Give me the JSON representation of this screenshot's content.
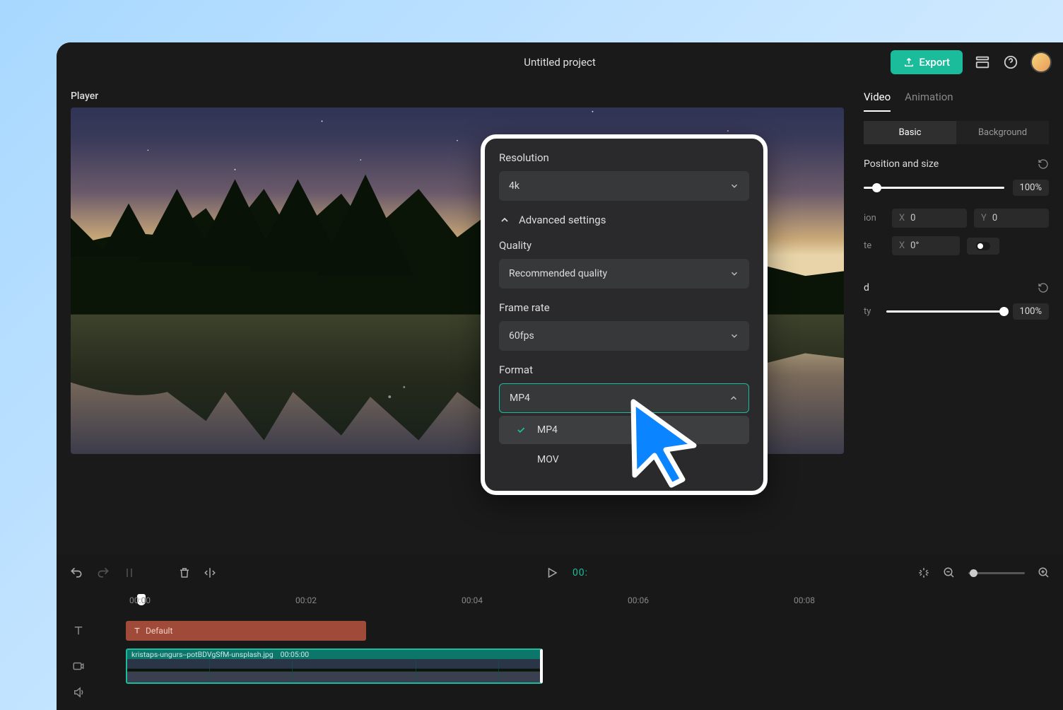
{
  "titlebar": {
    "title": "Untitled project",
    "export_label": "Export"
  },
  "player": {
    "label": "Player"
  },
  "rightPanel": {
    "tabs": {
      "video": "Video",
      "animation": "Animation"
    },
    "subtabs": {
      "basic": "Basic",
      "background": "Background"
    },
    "posSize": {
      "heading": "Position and size",
      "scale_pct": "100%",
      "pos_label_part": "ion",
      "posX": "0",
      "posY": "0",
      "rotate_label_part": "te",
      "rotX": "0°"
    },
    "blend": {
      "heading_part": "d",
      "opacity_label_part": "ty",
      "opacity_pct": "100%"
    }
  },
  "toolbar": {
    "time": "00:"
  },
  "ruler": {
    "marks": [
      "00:00",
      "00:02",
      "00:04",
      "00:06",
      "00:08"
    ]
  },
  "tracks": {
    "textClip": "Default",
    "videoClip": {
      "filename": "kristaps-ungurs--potBDVgSfM-unsplash.jpg",
      "duration": "00:05:00"
    }
  },
  "export": {
    "resolution_label": "Resolution",
    "resolution_value": "4k",
    "advanced_label": "Advanced settings",
    "quality_label": "Quality",
    "quality_value": "Recommended quality",
    "framerate_label": "Frame rate",
    "framerate_value": "60fps",
    "format_label": "Format",
    "format_value": "MP4",
    "options": {
      "mp4": "MP4",
      "mov": "MOV"
    }
  }
}
